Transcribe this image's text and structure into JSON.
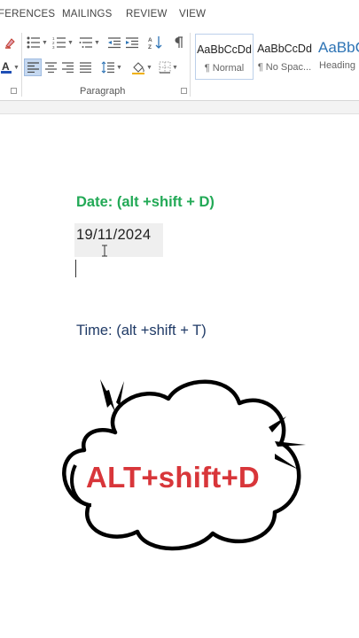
{
  "ribbon_tabs": [
    "FERENCES",
    "MAILINGS",
    "REVIEW",
    "VIEW"
  ],
  "paragraph_group": {
    "label": "Paragraph"
  },
  "styles": [
    {
      "sample": "AaBbCcDd",
      "name": "¶ Normal"
    },
    {
      "sample": "AaBbCcDd",
      "name": "¶ No Spac..."
    },
    {
      "sample": "AaBbC",
      "name": "Heading"
    }
  ],
  "document": {
    "date_label": "Date:  (alt +shift + D)",
    "date_value": "19/11/2024",
    "time_label": "Time: (alt +shift + T)",
    "callout_text": "ALT+shift+D"
  },
  "colors": {
    "date_label": "#22a956",
    "time_label": "#1f3a66",
    "callout_text": "#d8363a",
    "style_heading": "#2e74b5"
  },
  "icons": [
    "font-color-icon",
    "highlight-icon",
    "bullets-icon",
    "numbering-icon",
    "multilevel-list-icon",
    "decrease-indent-icon",
    "increase-indent-icon",
    "sort-icon",
    "show-formatting-icon",
    "align-left-icon",
    "align-center-icon",
    "align-right-icon",
    "justify-icon",
    "line-spacing-icon",
    "shading-icon",
    "borders-icon",
    "text-cursor-icon",
    "speech-burst-icon"
  ]
}
